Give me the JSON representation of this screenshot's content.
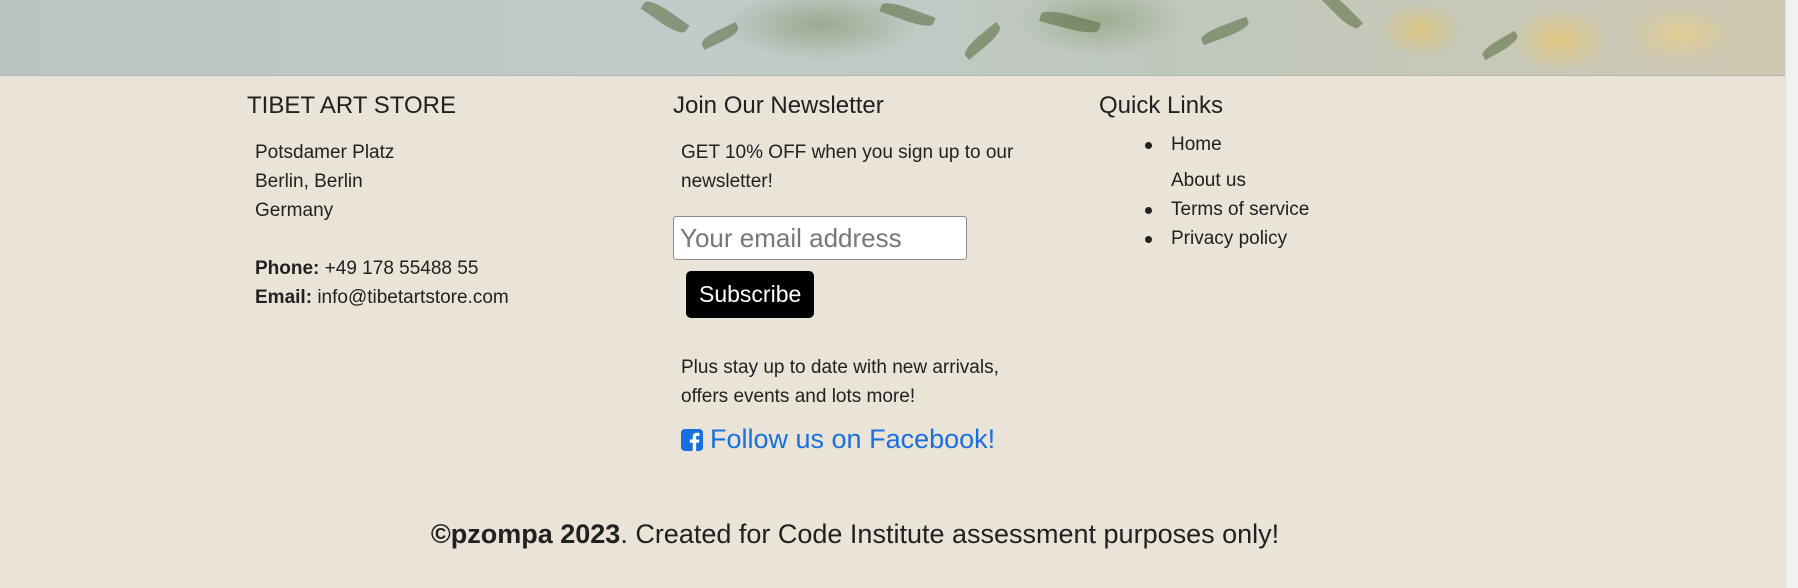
{
  "hero": {
    "image_label": "dried flowers banner"
  },
  "store": {
    "heading": "TIBET ART STORE",
    "address_line1": "Potsdamer Platz",
    "address_line2": "Berlin, Berlin",
    "address_line3": "Germany",
    "phone_label": "Phone:",
    "phone_value": "+49 178 55488 55",
    "email_label": "Email:",
    "email_value": "info@tibetartstore.com"
  },
  "newsletter": {
    "heading": "Join Our Newsletter",
    "intro": "GET 10% OFF when you sign up to our newsletter!",
    "email_placeholder": "Your email address",
    "subscribe_label": "Subscribe",
    "outro": "Plus stay up to date with new arrivals, offers events and lots more!",
    "facebook_label": "Follow us on Facebook!",
    "facebook_icon": "facebook-square-icon",
    "link_color": "#1a6fe0"
  },
  "quick_links": {
    "heading": "Quick Links",
    "items": [
      {
        "label": "Home",
        "bullet": true
      },
      {
        "label": "About us",
        "bullet": false
      },
      {
        "label": "Terms of service",
        "bullet": true
      },
      {
        "label": "Privacy policy",
        "bullet": true
      }
    ]
  },
  "footer": {
    "copyright_owner": "©pzompa 2023",
    "copyright_text": ".  Created for Code Institute assessment purposes only!"
  },
  "colors": {
    "background": "#e9e3d8",
    "button": "#000000",
    "text": "#212121"
  }
}
